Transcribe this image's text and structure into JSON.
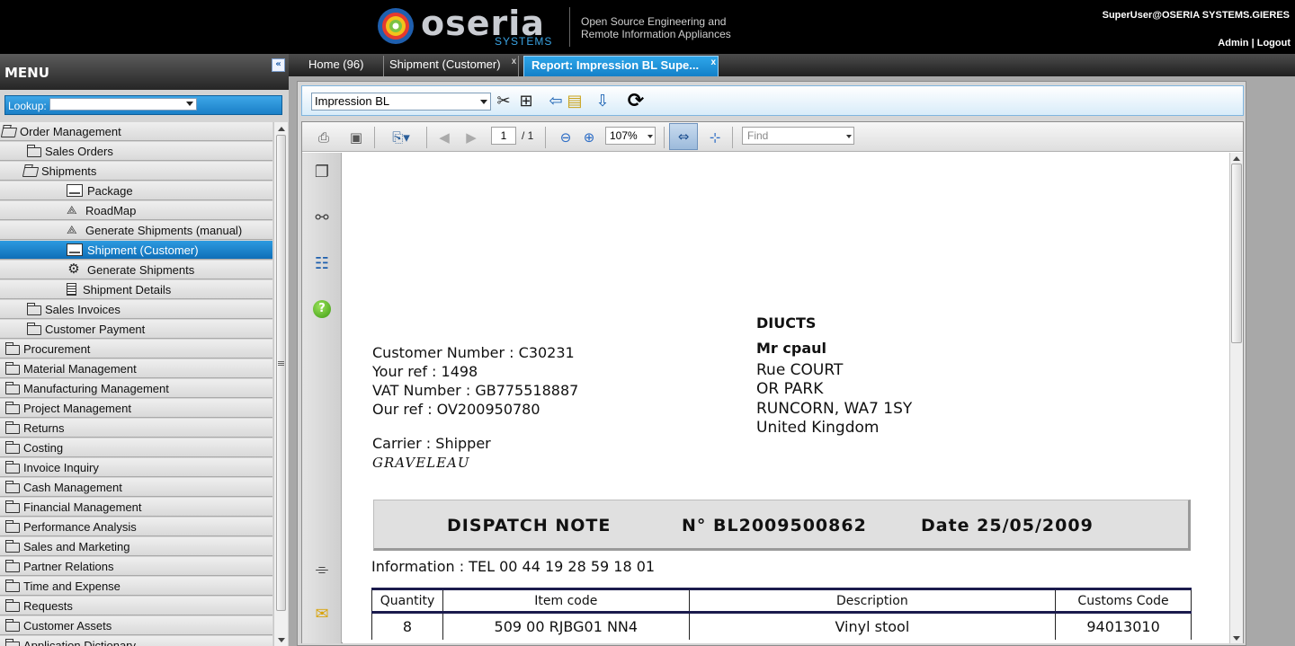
{
  "header": {
    "logo_text": "oseria",
    "logo_sub": "SYSTEMS",
    "tagline_line1": "Open Source Engineering and",
    "tagline_line2": "Remote Information Appliances",
    "user": "SuperUser@OSERIA SYSTEMS.GIERES",
    "admin_link": "Admin",
    "separator": " | ",
    "logout_link": "Logout"
  },
  "menu": {
    "title": "MENU",
    "collapse": "«",
    "lookup_label": "Lookup:",
    "lookup_value": "",
    "items": [
      {
        "label": "Order Management",
        "icon": "folder-open-icon"
      },
      {
        "label": "Sales Orders",
        "icon": "folder-icon"
      },
      {
        "label": "Shipments",
        "icon": "folder-open-icon"
      },
      {
        "label": "Package",
        "icon": "window-icon"
      },
      {
        "label": "RoadMap",
        "icon": "workflow-icon"
      },
      {
        "label": "Generate Shipments (manual)",
        "icon": "workflow-icon"
      },
      {
        "label": "Shipment (Customer)",
        "icon": "window-icon"
      },
      {
        "label": "Generate Shipments",
        "icon": "gear-icon"
      },
      {
        "label": "Shipment Details",
        "icon": "report-icon"
      },
      {
        "label": "Sales Invoices",
        "icon": "folder-icon"
      },
      {
        "label": "Customer Payment",
        "icon": "folder-icon"
      },
      {
        "label": "Procurement",
        "icon": "folder-icon"
      },
      {
        "label": "Material Management",
        "icon": "folder-icon"
      },
      {
        "label": "Manufacturing Management",
        "icon": "folder-icon"
      },
      {
        "label": "Project Management",
        "icon": "folder-icon"
      },
      {
        "label": "Returns",
        "icon": "folder-icon"
      },
      {
        "label": "Costing",
        "icon": "folder-icon"
      },
      {
        "label": "Invoice Inquiry",
        "icon": "folder-icon"
      },
      {
        "label": "Cash Management",
        "icon": "folder-icon"
      },
      {
        "label": "Financial Management",
        "icon": "folder-icon"
      },
      {
        "label": "Performance Analysis",
        "icon": "folder-icon"
      },
      {
        "label": "Sales and Marketing",
        "icon": "folder-icon"
      },
      {
        "label": "Partner Relations",
        "icon": "folder-icon"
      },
      {
        "label": "Time and Expense",
        "icon": "folder-icon"
      },
      {
        "label": "Requests",
        "icon": "folder-icon"
      },
      {
        "label": "Customer Assets",
        "icon": "folder-icon"
      },
      {
        "label": "Application Dictionary",
        "icon": "folder-icon"
      }
    ],
    "selected": "Shipment (Customer)"
  },
  "tabs": [
    {
      "label": "Home (96)",
      "active": false
    },
    {
      "label": "Shipment (Customer)",
      "active": false,
      "close": "x"
    },
    {
      "label": "Report: Impression BL Supe...",
      "active": true,
      "close": "x"
    }
  ],
  "report_toolbar": {
    "report_select": "Impression BL",
    "icons": [
      "tools-icon",
      "binoculars-icon",
      "export-icon",
      "archive-icon",
      "download-icon",
      "refresh-icon"
    ]
  },
  "viewer": {
    "page_current": "1",
    "page_total": "/ 1",
    "zoom": "107%",
    "find_placeholder": "Find"
  },
  "document": {
    "addressee_company": "DIUCTS",
    "addressee_name": "Mr  cpaul",
    "address_line1": "Rue COURT",
    "address_line2": "OR PARK",
    "address_line3": "RUNCORN,  WA7 1SY",
    "address_country": "United Kingdom",
    "customer_number": "Customer Number : C30231",
    "your_ref": "Your ref : 1498",
    "vat_number": "VAT Number : GB775518887",
    "our_ref": "Our ref : OV200950780",
    "carrier": "Carrier : Shipper",
    "carrier_name": "GRAVELEAU",
    "banner_title": "DISPATCH NOTE",
    "banner_number": "N° BL2009500862",
    "banner_date": "Date 25/05/2009",
    "information": "Information : TEL 00 44 19 28 59 18 01",
    "table": {
      "headers": [
        "Quantity",
        "Item code",
        "Description",
        "Customs Code"
      ],
      "rows": [
        [
          "8",
          "509 00 RJBG01 NN4",
          "Vinyl stool",
          "94013010"
        ]
      ]
    }
  },
  "colors": {
    "accent_blue": "#1a7fc7",
    "header_bg": "#000000",
    "selected_row": "#0f6fb8"
  }
}
